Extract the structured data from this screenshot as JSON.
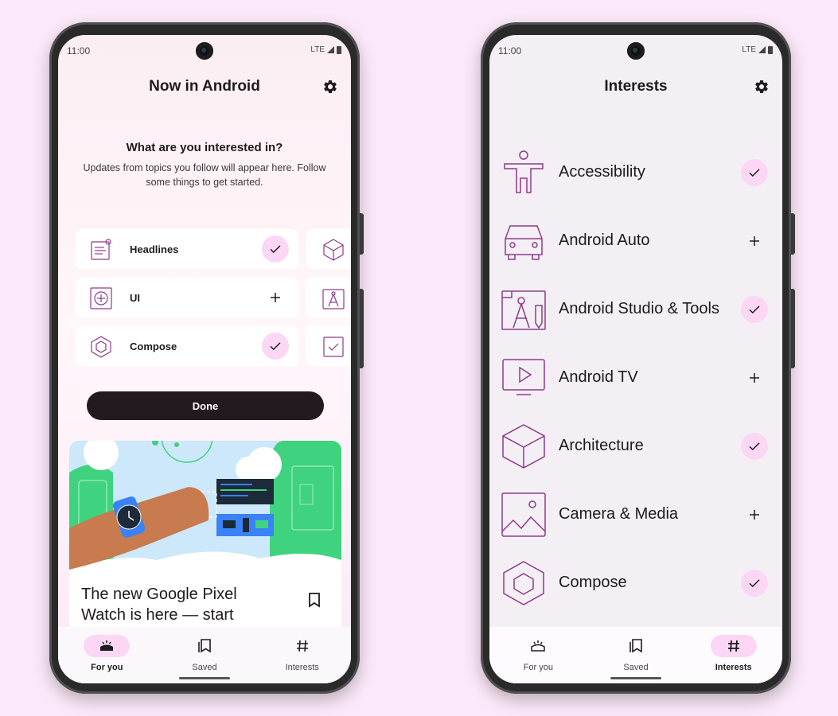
{
  "status": {
    "time": "11:00",
    "network": "LTE"
  },
  "left": {
    "app_title": "Now in Android",
    "onboarding": {
      "title": "What are you interested in?",
      "subtitle": "Updates from topics you follow will appear here. Follow some things to get started."
    },
    "chips": [
      {
        "label": "Headlines",
        "icon": "newspaper-icon",
        "followed": true
      },
      {
        "label": "UI",
        "icon": "plus-square-icon",
        "followed": false
      },
      {
        "label": "Compose",
        "icon": "hexagon-icon",
        "followed": true
      }
    ],
    "done_label": "Done",
    "news": {
      "title": "The new Google Pixel Watch is here — start",
      "bookmarked": false
    },
    "nav": [
      {
        "label": "For you",
        "icon": "for-you-icon",
        "active": true
      },
      {
        "label": "Saved",
        "icon": "bookmarks-icon",
        "active": false
      },
      {
        "label": "Interests",
        "icon": "hashtag-icon",
        "active": false
      }
    ]
  },
  "right": {
    "app_title": "Interests",
    "interests": [
      {
        "label": "Accessibility",
        "icon": "accessibility-icon",
        "followed": true
      },
      {
        "label": "Android Auto",
        "icon": "car-icon",
        "followed": false
      },
      {
        "label": "Android Studio & Tools",
        "icon": "studio-tools-icon",
        "followed": true
      },
      {
        "label": "Android TV",
        "icon": "tv-icon",
        "followed": false
      },
      {
        "label": "Architecture",
        "icon": "cube-icon",
        "followed": true
      },
      {
        "label": "Camera & Media",
        "icon": "image-icon",
        "followed": false
      },
      {
        "label": "Compose",
        "icon": "hexagon-icon",
        "followed": true
      }
    ],
    "nav": [
      {
        "label": "For you",
        "icon": "for-you-icon",
        "active": false
      },
      {
        "label": "Saved",
        "icon": "bookmarks-icon",
        "active": false
      },
      {
        "label": "Interests",
        "icon": "hashtag-icon",
        "active": true
      }
    ]
  },
  "colors": {
    "accent_container": "#fbd7f5",
    "icon_purple": "#8e3b8c",
    "done_button": "#231a1f",
    "background": "#fbe8f8"
  }
}
